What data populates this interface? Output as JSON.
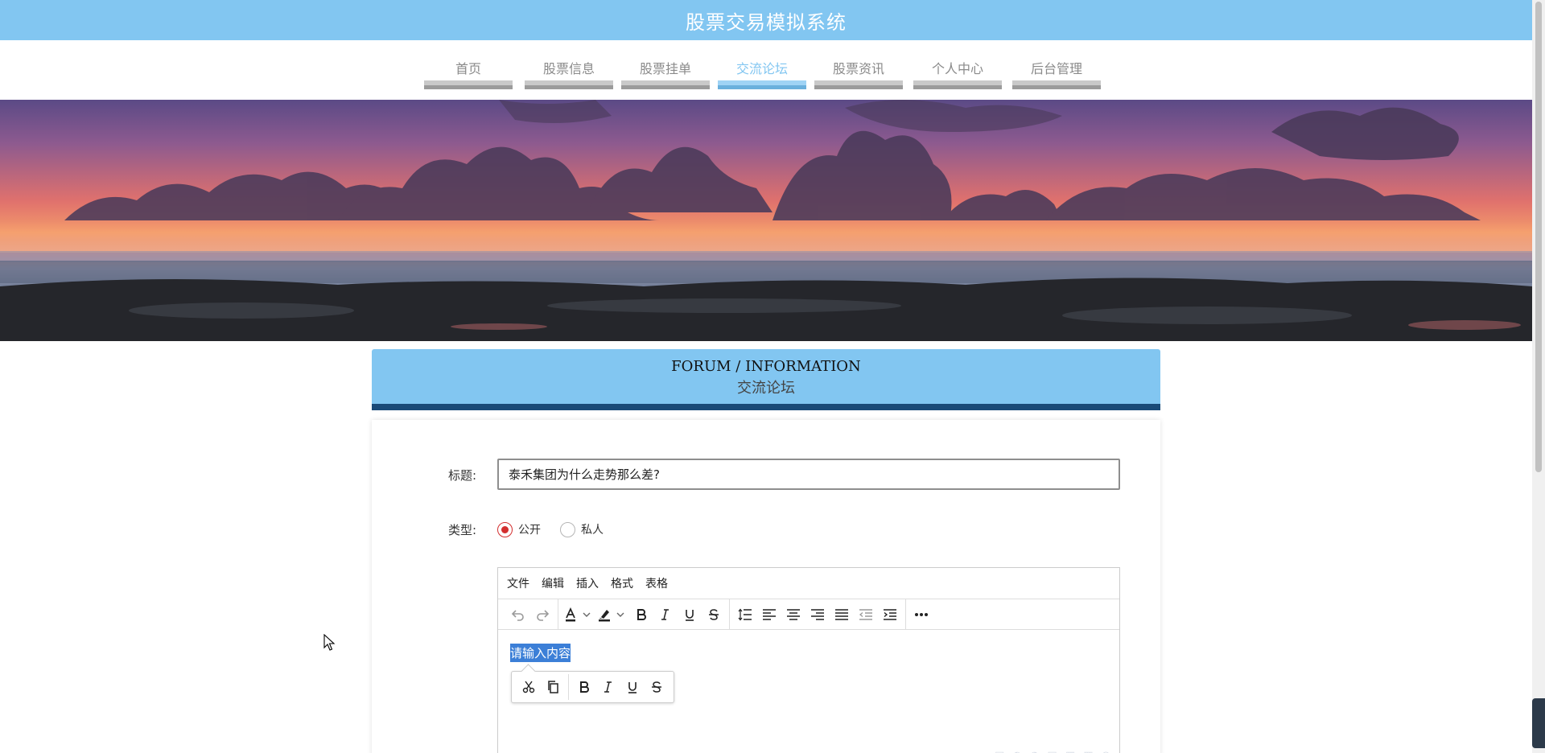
{
  "header": {
    "title": "股票交易模拟系统"
  },
  "nav": {
    "items": [
      {
        "label": "首页"
      },
      {
        "label": "股票信息"
      },
      {
        "label": "股票挂单"
      },
      {
        "label": "交流论坛"
      },
      {
        "label": "股票资讯"
      },
      {
        "label": "个人中心"
      },
      {
        "label": "后台管理"
      }
    ],
    "active": "交流论坛"
  },
  "section": {
    "title_en": "FORUM / INFORMATION",
    "title_zh": "交流论坛"
  },
  "form": {
    "title_label": "标题:",
    "title_value": "泰禾集团为什么走势那么差?",
    "type_label": "类型:",
    "type_options": [
      {
        "label": "公开",
        "checked": true
      },
      {
        "label": "私人",
        "checked": false
      }
    ]
  },
  "editor": {
    "menus": [
      "文件",
      "编辑",
      "插入",
      "格式",
      "表格"
    ],
    "placeholder": "请输入内容",
    "toolbar_icons": [
      "undo-icon",
      "redo-icon",
      "text-color-icon",
      "highlight-icon",
      "bold-icon",
      "italic-icon",
      "underline-icon",
      "strikethrough-icon",
      "line-height-icon",
      "align-left-icon",
      "align-center-icon",
      "align-right-icon",
      "align-justify-icon",
      "outdent-icon",
      "indent-icon",
      "more-icon"
    ],
    "inline_toolbar_icons": [
      "cut-icon",
      "copy-icon",
      "bold-icon",
      "italic-icon",
      "underline-icon",
      "strikethrough-icon"
    ]
  },
  "colors": {
    "primary": "#82c6f1",
    "primary_dark": "#1a4a78",
    "radio_checked": "#d32f2f",
    "selection": "#3c7fd7"
  }
}
